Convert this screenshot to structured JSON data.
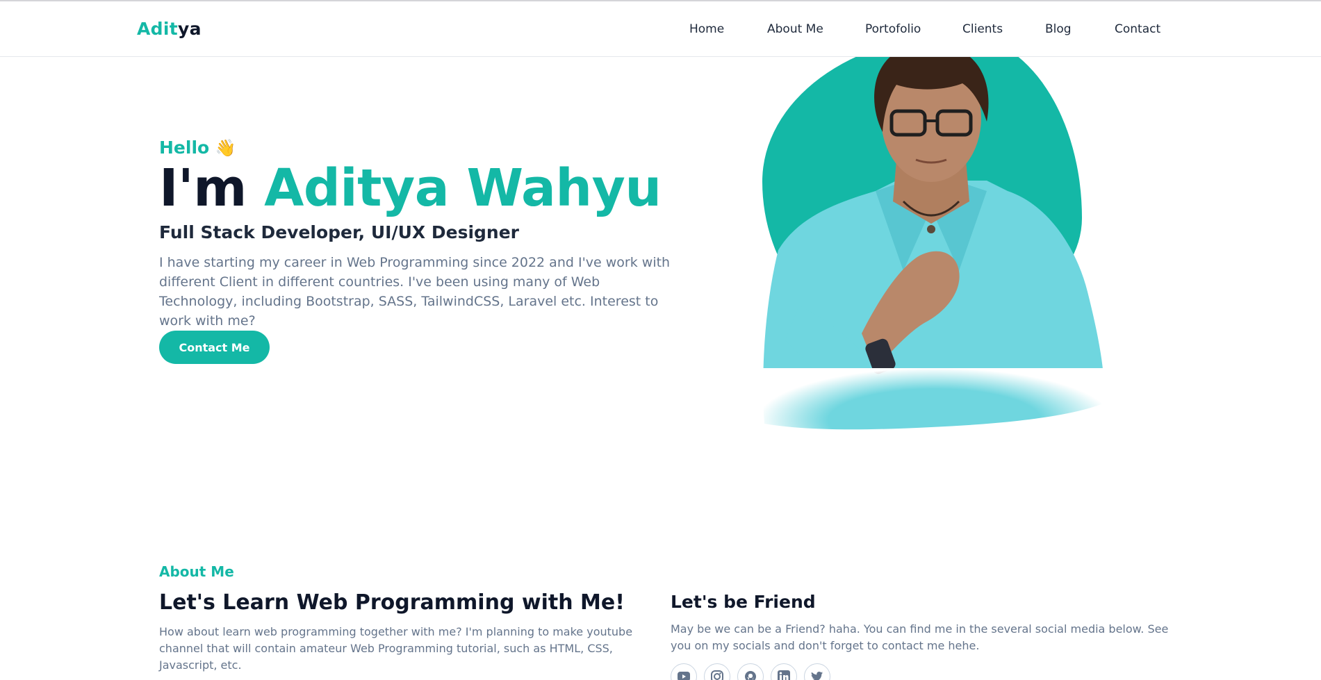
{
  "brand": {
    "logo_part1": "Adit",
    "logo_part2": "ya"
  },
  "nav": {
    "items": [
      {
        "label": "Home"
      },
      {
        "label": "About Me"
      },
      {
        "label": "Portofolio"
      },
      {
        "label": "Clients"
      },
      {
        "label": "Blog"
      },
      {
        "label": "Contact"
      }
    ]
  },
  "hero": {
    "greeting": "Hello",
    "greeting_emoji": "👋",
    "title_prefix": "I'm",
    "title_name": "Aditya Wahyu",
    "role": "Full Stack Developer, UI/UX Designer",
    "description": "I have starting my career in Web Programming since 2022 and I've work with different Client in different countries. I've been using many of Web Technology, including Bootstrap, SASS, TailwindCSS, Laravel etc. Interest to work with me?",
    "cta_label": "Contact Me"
  },
  "about": {
    "label": "About Me",
    "title": "Let's Learn Web Programming with Me!",
    "description": "How about learn web programming together with me? I'm planning to make youtube channel that will contain amateur Web Programming tutorial, such as HTML, CSS, Javascript, etc."
  },
  "friend": {
    "title": "Let's be Friend",
    "description": "May be we can be a Friend? haha. You can find me in the several social media below. See you on my socials and don't forget to contact me hehe.",
    "socials": [
      "youtube-icon",
      "instagram-icon",
      "github-icon",
      "linkedin-icon",
      "twitter-icon"
    ]
  },
  "colors": {
    "accent": "#14b8a6",
    "heading": "#0f172a",
    "body_text": "#64748b",
    "shirt": "#6fd6df"
  }
}
